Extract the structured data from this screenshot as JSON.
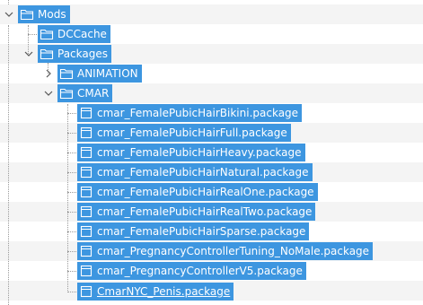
{
  "tree": {
    "root": {
      "label": "Mods",
      "expanded": true,
      "icon": "folder-icon"
    },
    "children": [
      {
        "label": "DCCache",
        "icon": "folder-icon"
      },
      {
        "label": "Packages",
        "expanded": true,
        "icon": "folder-icon"
      }
    ],
    "packages_children": [
      {
        "label": "ANIMATION",
        "expanded": false,
        "icon": "folder-icon"
      },
      {
        "label": "CMAR",
        "expanded": true,
        "icon": "folder-icon"
      }
    ],
    "files": [
      {
        "label": "cmar_FemalePubicHairBikini.package",
        "icon": "package-file-icon"
      },
      {
        "label": "cmar_FemalePubicHairFull.package",
        "icon": "package-file-icon"
      },
      {
        "label": "cmar_FemalePubicHairHeavy.package",
        "icon": "package-file-icon"
      },
      {
        "label": "cmar_FemalePubicHairNatural.package",
        "icon": "package-file-icon"
      },
      {
        "label": "cmar_FemalePubicHairRealOne.package",
        "icon": "package-file-icon"
      },
      {
        "label": "cmar_FemalePubicHairRealTwo.package",
        "icon": "package-file-icon"
      },
      {
        "label": "cmar_FemalePubicHairSparse.package",
        "icon": "package-file-icon"
      },
      {
        "label": "cmar_PregnancyControllerTuning_NoMale.package",
        "icon": "package-file-icon"
      },
      {
        "label": "cmar_PregnancyControllerV5.package",
        "icon": "package-file-icon"
      },
      {
        "label": "CmarNYC_Penis.package",
        "icon": "package-file-icon"
      }
    ]
  },
  "colors": {
    "selection": "#3d96e0",
    "stripe": "#f4f4f4",
    "text_selected": "#ffffff"
  }
}
